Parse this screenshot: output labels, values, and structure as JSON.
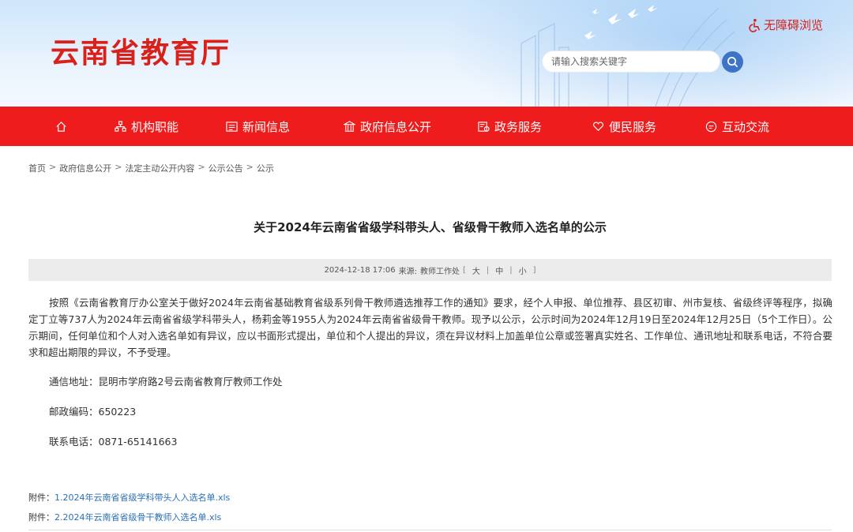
{
  "header": {
    "site_title": "云南省教育厅",
    "accessibility_label": "无障碍浏览",
    "search_placeholder": "请输入搜索关键字"
  },
  "nav": {
    "items": [
      {
        "label": "",
        "icon": "home-icon"
      },
      {
        "label": "机构职能",
        "icon": "org-icon"
      },
      {
        "label": "新闻信息",
        "icon": "news-icon"
      },
      {
        "label": "政府信息公开",
        "icon": "gov-building-icon"
      },
      {
        "label": "政务服务",
        "icon": "service-icon"
      },
      {
        "label": "便民服务",
        "icon": "heart-hand-icon"
      },
      {
        "label": "互动交流",
        "icon": "chat-icon"
      }
    ]
  },
  "breadcrumb": [
    "首页",
    "政府信息公开",
    "法定主动公开内容",
    "公示公告",
    "公示"
  ],
  "article": {
    "title": "关于2024年云南省省级学科带头人、省级骨干教师入选名单的公示",
    "meta_date": "2024-12-18 17:06",
    "meta_source_label": "来源:",
    "meta_source": "教师工作处",
    "font_sizes": [
      "大",
      "中",
      "小"
    ],
    "body": "按照《云南省教育厅办公室关于做好2024年云南省基础教育省级系列骨干教师遴选推荐工作的通知》要求，经个人申报、单位推荐、县区初审、州市复核、省级终评等程序，拟确定丁立等737人为2024年云南省省级学科带头人，杨莉金等1955人为2024年云南省省级骨干教师。现予以公示，公示时间为2024年12月19日至2024年12月25日（5个工作日）。公示期间，任何单位和个人对入选名单如有异议，应以书面形式提出，单位和个人提出的异议，须在异议材料上加盖单位公章或签署真实姓名、工作单位、通讯地址和联系电话，不符合要求和超出期限的异议，不予受理。",
    "address": "通信地址：昆明市学府路2号云南省教育厅教师工作处",
    "postcode": "邮政编码：650223",
    "phone": "联系电话：0871-65141663"
  },
  "attachments": [
    {
      "prefix": "附件：",
      "name": "1.2024年云南省省级学科带头人入选名单.xls"
    },
    {
      "prefix": "附件：",
      "name": "2.2024年云南省省级骨干教师入选名单.xls"
    }
  ],
  "colors": {
    "brand_red": "#d8211b",
    "nav_red": "#ee1c1c",
    "link_blue": "#2a6fb5",
    "search_blue": "#3d74c7"
  }
}
